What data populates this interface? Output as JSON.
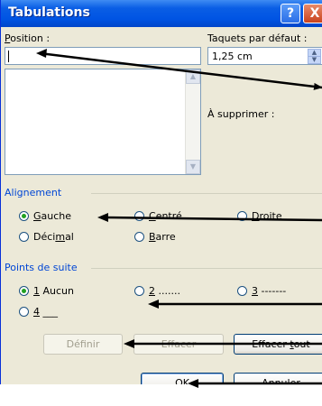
{
  "window": {
    "title": "Tabulations"
  },
  "titlebar_buttons": {
    "help": "?",
    "close": "X"
  },
  "position": {
    "label_first": "P",
    "label_rest": "osition :",
    "value": ""
  },
  "default_stops": {
    "label": "Taquets par défaut :",
    "value": "1,25 cm"
  },
  "to_clear": {
    "label": "À supprimer :"
  },
  "alignment": {
    "title": "Alignement",
    "options": [
      {
        "key": "G",
        "rest": "auche",
        "checked": true
      },
      {
        "key": "C",
        "rest": "entré",
        "checked": false
      },
      {
        "key": "D",
        "rest": "roite",
        "checked": false
      },
      {
        "pre": "Déci",
        "key": "m",
        "rest": "al",
        "checked": false
      },
      {
        "key": "B",
        "rest": "arre",
        "checked": false
      }
    ]
  },
  "leader": {
    "title": "Points de suite",
    "options": [
      {
        "key": "1",
        "rest": " Aucun",
        "checked": true
      },
      {
        "key": "2",
        "rest": " .......",
        "checked": false
      },
      {
        "key": "3",
        "rest": " -------",
        "checked": false
      },
      {
        "key": "4",
        "rest": " ___",
        "checked": false
      }
    ]
  },
  "buttons": {
    "set": "Définir",
    "clear": "Effacer",
    "clear_all_pre": "Effacer ",
    "clear_all_key": "t",
    "clear_all_rest": "out",
    "ok": "OK",
    "cancel": "Annuler"
  },
  "colors": {
    "titlebar": "#0054e3",
    "dialog_bg": "#ece9d8",
    "group_title": "#0046d5",
    "radio_dot": "#21a121"
  }
}
